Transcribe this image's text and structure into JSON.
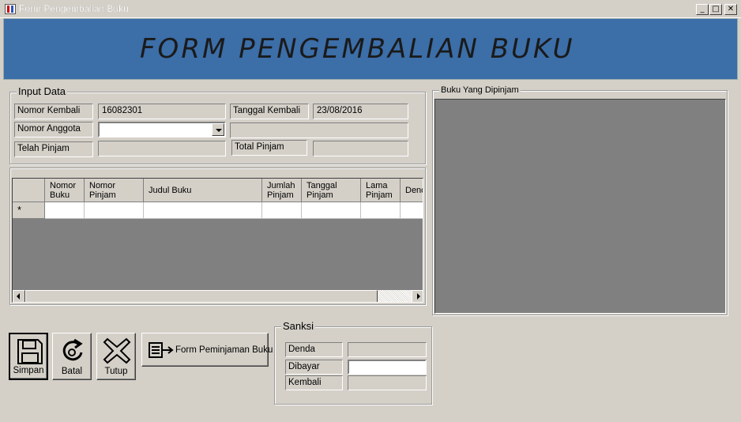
{
  "window": {
    "title": "Form Pengembalian Buku",
    "minimize_glyph": "_",
    "maximize_glyph": "□",
    "close_glyph": "✕"
  },
  "banner": {
    "heading": "FORM PENGEMBALIAN BUKU",
    "background": "#3c6ea8"
  },
  "input_data": {
    "legend": "Input Data",
    "nomor_kembali_label": "Nomor Kembali",
    "nomor_kembali_value": "16082301",
    "tanggal_kembali_label": "Tanggal Kembali",
    "tanggal_kembali_value": "23/08/2016",
    "nomor_anggota_label": "Nomor Anggota",
    "nomor_anggota_value": "",
    "nama_anggota_value": "",
    "telah_pinjam_label": "Telah Pinjam",
    "telah_pinjam_value": "",
    "total_pinjam_label": "Total Pinjam",
    "total_pinjam_value": ""
  },
  "grid": {
    "columns": [
      "Nomor Buku",
      "Nomor Pinjam",
      "Judul Buku",
      "Jumlah Pinjam",
      "Tanggal Pinjam",
      "Lama Pinjam",
      "Denda"
    ],
    "new_row_marker": "*"
  },
  "buku_panel": {
    "legend": "Buku Yang Dipinjam"
  },
  "buttons": {
    "simpan": "Simpan",
    "batal": "Batal",
    "tutup": "Tutup",
    "form_peminjaman": "Form Peminjaman Buku"
  },
  "sanksi": {
    "legend": "Sanksi",
    "denda_label": "Denda",
    "denda_value": "",
    "dibayar_label": "Dibayar",
    "dibayar_value": "",
    "kembali_label": "Kembali",
    "kembali_value": ""
  }
}
